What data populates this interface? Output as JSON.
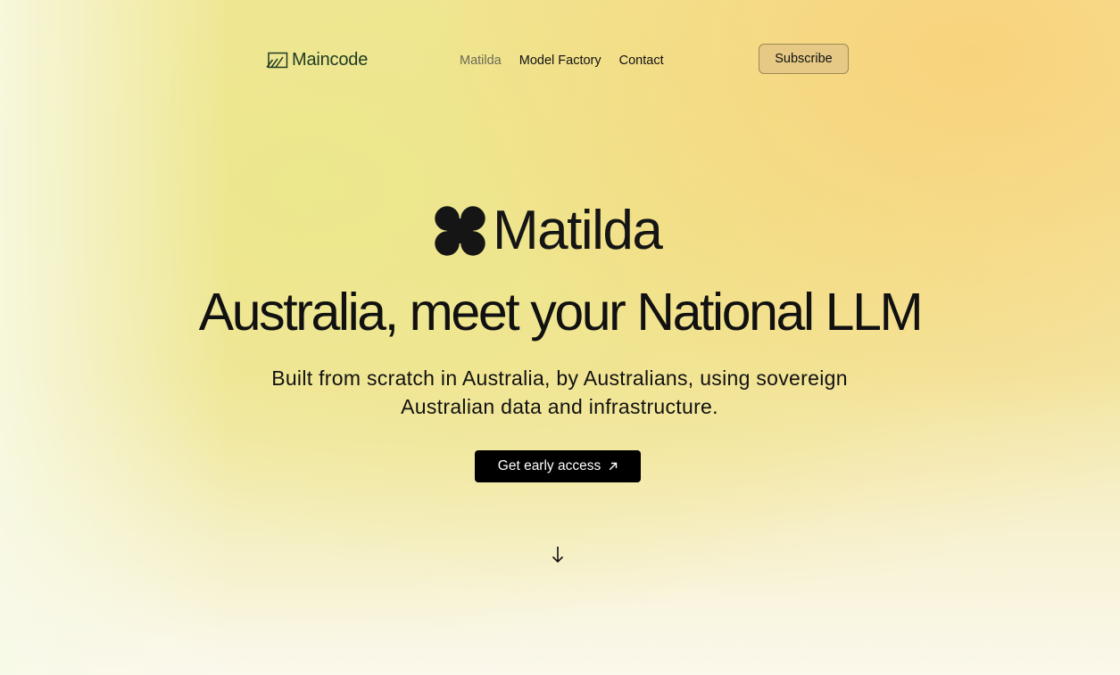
{
  "nav": {
    "logo_text": "Maincode",
    "links": [
      {
        "label": "Matilda",
        "active": true
      },
      {
        "label": "Model Factory",
        "active": false
      },
      {
        "label": "Contact",
        "active": false
      }
    ],
    "subscribe_label": "Subscribe"
  },
  "hero": {
    "product_name": "Matilda",
    "headline": "Australia, meet your National LLM",
    "subheading": "Built from scratch in Australia, by Australians, using sovereign Australian data and infrastructure.",
    "cta_label": "Get early access"
  },
  "icons": {
    "logo_mark": "maincode-logo-icon",
    "product_mark": "clover-logo-icon",
    "cta_icon": "arrow-up-right-icon",
    "scroll_icon": "arrow-down-icon"
  },
  "colors": {
    "brand_green": "#1f3a24",
    "subscribe_bg": "#e6c985",
    "cta_bg": "#000000",
    "background_yellow": "#f4e59a",
    "background_orange": "#f9d078"
  }
}
